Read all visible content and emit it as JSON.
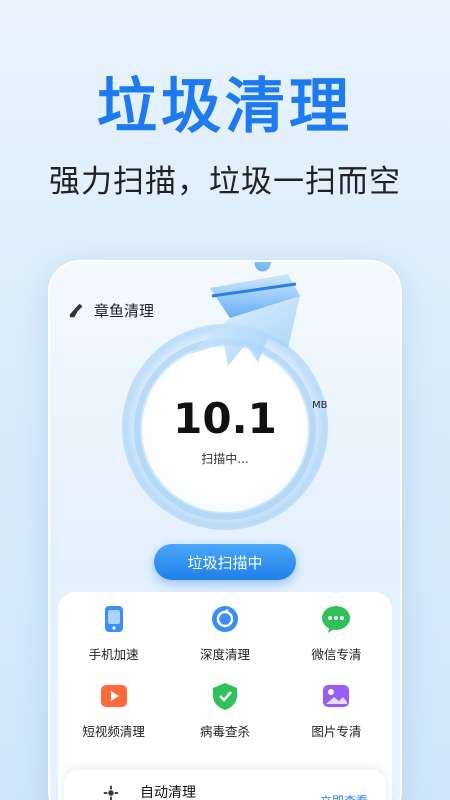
{
  "promo": {
    "headline": "垃圾清理",
    "subline": "强力扫描，垃圾一扫而空"
  },
  "app": {
    "title": "章鱼清理"
  },
  "scan": {
    "size_value": "10.1",
    "size_unit": "MB",
    "status": "扫描中...",
    "button_label": "垃圾扫描中"
  },
  "features": [
    {
      "label": "手机加速",
      "icon": "phone-speed-icon",
      "color": "#3b8ef5"
    },
    {
      "label": "深度清理",
      "icon": "deep-clean-icon",
      "color": "#3b8ef5"
    },
    {
      "label": "微信专清",
      "icon": "wechat-icon",
      "color": "#2fc25b"
    },
    {
      "label": "短视频清理",
      "icon": "video-icon",
      "color": "#ff6a3d"
    },
    {
      "label": "病毒查杀",
      "icon": "shield-icon",
      "color": "#2fc25b"
    },
    {
      "label": "图片专清",
      "icon": "image-icon",
      "color": "#9b5cf6"
    }
  ],
  "auto_clean": {
    "title": "自动清理",
    "link": "立即查看"
  },
  "colors": {
    "accent": "#1e7af0"
  }
}
